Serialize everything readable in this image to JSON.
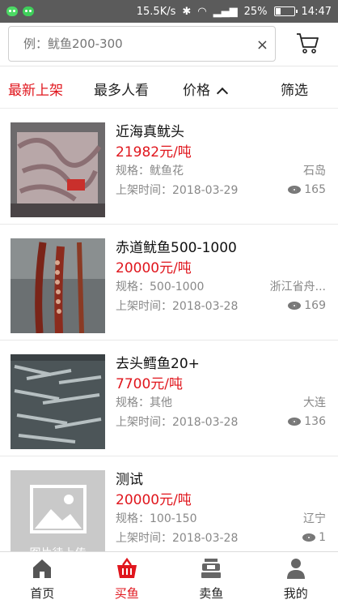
{
  "status_bar": {
    "speed": "15.5K/s",
    "battery": "25%",
    "time": "14:47"
  },
  "search": {
    "placeholder": "例：鱿鱼200-300",
    "clear": "×"
  },
  "sort_tabs": [
    {
      "label": "最新上架",
      "active": true
    },
    {
      "label": "最多人看",
      "active": false
    },
    {
      "label": "价格",
      "active": false
    },
    {
      "label": "筛选",
      "active": false
    }
  ],
  "products": [
    {
      "name": "近海真鱿头",
      "price": "21982元/吨",
      "spec": "规格：鱿鱼花",
      "location": "石岛",
      "listed": "上架时间：2018-03-29",
      "views": "165"
    },
    {
      "name": "赤道鱿鱼500-1000",
      "price": "20000元/吨",
      "spec": "规格：500-1000",
      "location": "浙江省舟...",
      "listed": "上架时间：2018-03-28",
      "views": "169"
    },
    {
      "name": "去头鳕鱼20+",
      "price": "7700元/吨",
      "spec": "规格：其他",
      "location": "大连",
      "listed": "上架时间：2018-03-28",
      "views": "136"
    },
    {
      "name": "测试",
      "price": "20000元/吨",
      "spec": "规格：100-150",
      "location": "辽宁",
      "listed": "上架时间：2018-03-28",
      "views": "1",
      "placeholder_text": "图片待上传"
    }
  ],
  "bottom_nav": [
    {
      "label": "首页",
      "icon": "home-icon",
      "active": false
    },
    {
      "label": "买鱼",
      "icon": "basket-icon",
      "active": true
    },
    {
      "label": "卖鱼",
      "icon": "scale-icon",
      "active": false
    },
    {
      "label": "我的",
      "icon": "person-icon",
      "active": false
    }
  ],
  "colors": {
    "accent": "#e0161d",
    "status_bar": "#5b5b5b"
  }
}
